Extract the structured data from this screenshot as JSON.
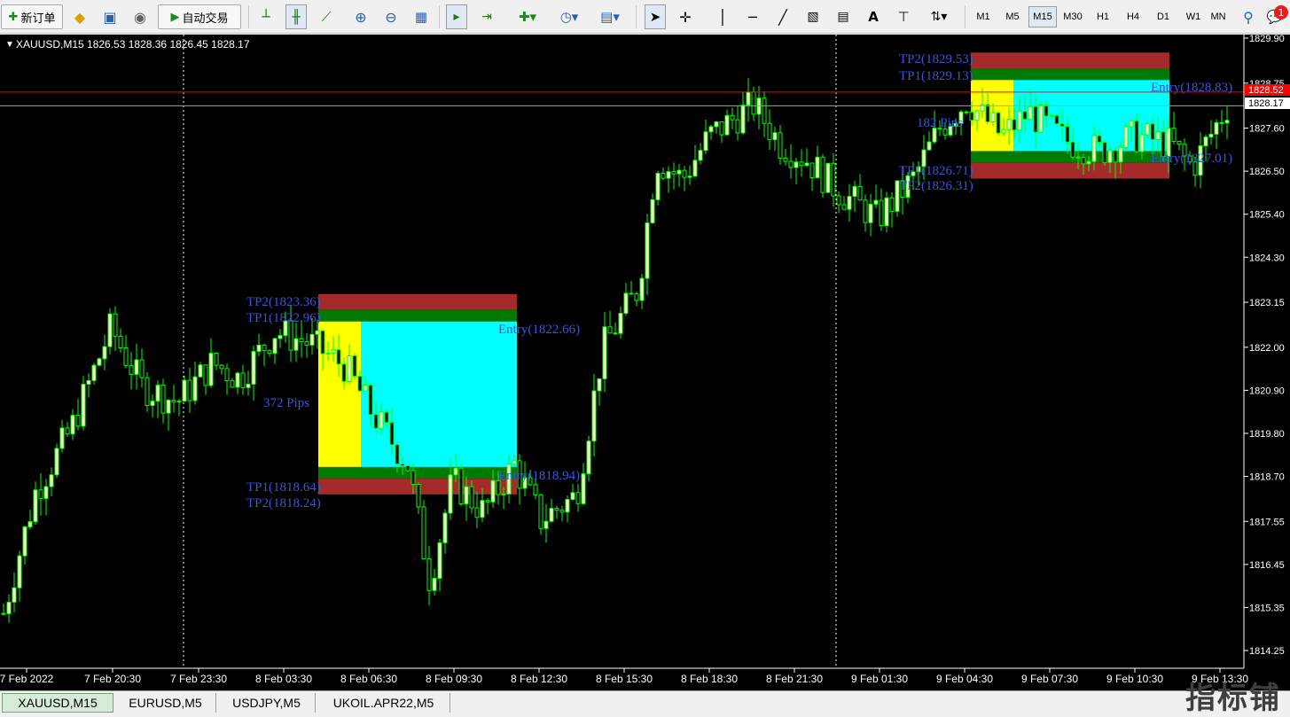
{
  "toolbar": {
    "new_order_label": "新订单",
    "auto_trade_label": "自动交易",
    "text_tool_label": "A",
    "timeframes": [
      "M1",
      "M5",
      "M15",
      "M30",
      "H1",
      "H4",
      "D1",
      "W1",
      "MN"
    ],
    "active_timeframe": "M15",
    "notification_count": "1"
  },
  "chart": {
    "header": "XAUUSD,M15  1826.53 1828.36 1826.45 1828.17",
    "bid_label": "1828.52",
    "last_label": "1828.17",
    "price_ticks": [
      "1829.90",
      "1828.75",
      "1827.60",
      "1826.50",
      "1825.40",
      "1824.30",
      "1823.15",
      "1822.00",
      "1820.90",
      "1819.80",
      "1818.70",
      "1817.55",
      "1816.45",
      "1815.35",
      "1814.25"
    ],
    "time_ticks": [
      "7 Feb 2022",
      "7 Feb 20:30",
      "7 Feb 23:30",
      "8 Feb 03:30",
      "8 Feb 06:30",
      "8 Feb 09:30",
      "8 Feb 12:30",
      "8 Feb 15:30",
      "8 Feb 18:30",
      "8 Feb 21:30",
      "9 Feb 01:30",
      "9 Feb 04:30",
      "9 Feb 07:30",
      "9 Feb 10:30",
      "9 Feb 13:30"
    ],
    "box1": {
      "tp2_top": "TP2(1823.36)",
      "tp1_top": "TP1(1822.96)",
      "entry_top": "Entry(1822.66)",
      "pips": "372 Pips",
      "entry_bottom": "Entry(1818.94)",
      "tp1_bottom": "TP1(1818.64)",
      "tp2_bottom": "TP2(1818.24)"
    },
    "box2": {
      "tp2_top": "TP2(1829.53)",
      "tp1_top": "TP1(1829.13)",
      "entry_top": "Entry(1828.83)",
      "pips": "182 Pips",
      "entry_bottom": "Entry(1827.01)",
      "tp1_bottom": "TP1(1826.71)",
      "tp2_bottom": "TP2(1826.31)"
    },
    "colors": {
      "background": "#000000",
      "candle_up": "#ffffcc",
      "candle_line": "#00ff00",
      "label_blue": "#3a56d8",
      "box_yellow": "#ffff00",
      "box_cyan": "#00ffff",
      "band_green": "#007a00",
      "band_red": "#a52a2a"
    }
  },
  "tabs": [
    "XAUUSD,M15",
    "EURUSD,M5",
    "USDJPY,M5",
    "UKOIL.APR22,M5"
  ],
  "active_tab": "XAUUSD,M15",
  "watermark": "指标铺"
}
